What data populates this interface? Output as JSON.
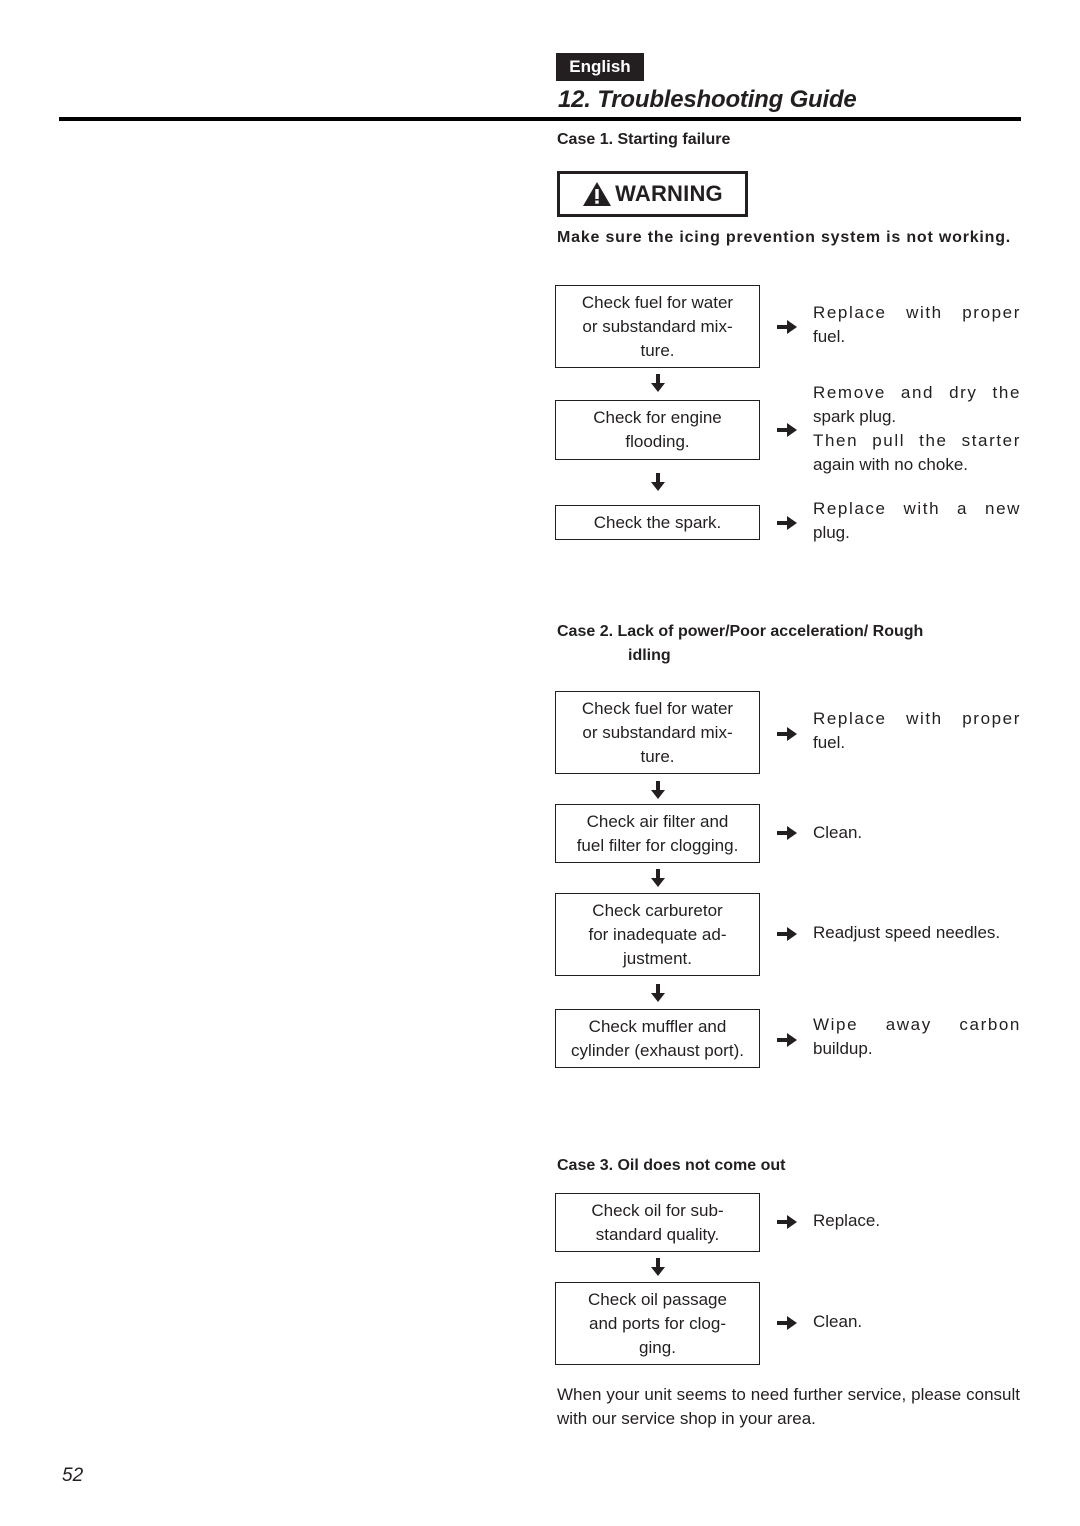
{
  "header": {
    "language_badge": "English",
    "section_title": "12. Troubleshooting Guide"
  },
  "case1": {
    "heading": "Case 1. Starting failure",
    "warning_label": "WARNING",
    "warning_icon": "warning-triangle-icon",
    "warning_note": "Make sure the icing prevention system is not working.",
    "steps": [
      {
        "check": "Check fuel for water\nor substandard mix-\nture.",
        "remedy_lines": [
          "Replace with proper",
          "fuel."
        ]
      },
      {
        "check": "Check for engine\nflooding.",
        "remedy_lines": [
          "Remove and dry the",
          "spark plug.",
          "Then pull the starter",
          "again with no choke."
        ]
      },
      {
        "check": "Check the spark.",
        "remedy_lines": [
          "Replace with a new",
          "plug."
        ]
      }
    ]
  },
  "case2": {
    "heading_line1": "Case 2. Lack of power/Poor acceleration/ Rough",
    "heading_line2": "idling",
    "steps": [
      {
        "check": "Check fuel for water\nor substandard mix-\nture.",
        "remedy_lines": [
          "Replace with proper",
          "fuel."
        ]
      },
      {
        "check": "Check air filter and\nfuel filter for clogging.",
        "remedy_lines": [
          "Clean."
        ]
      },
      {
        "check": "Check carburetor\nfor inadequate ad-\njustment.",
        "remedy_lines": [
          "Readjust speed needles."
        ]
      },
      {
        "check": "Check muffler and\ncylinder (exhaust port).",
        "remedy_lines": [
          "Wipe away carbon",
          "buildup."
        ]
      }
    ]
  },
  "case3": {
    "heading": "Case 3. Oil does not come out",
    "steps": [
      {
        "check": "Check oil for sub-\nstandard quality.",
        "remedy_lines": [
          "Replace."
        ]
      },
      {
        "check": "Check oil passage\nand ports for clog-\nging.",
        "remedy_lines": [
          "Clean."
        ]
      }
    ]
  },
  "footer_note": "When your unit seems to need further service, please consult with our service shop in your area.",
  "page_number": "52"
}
